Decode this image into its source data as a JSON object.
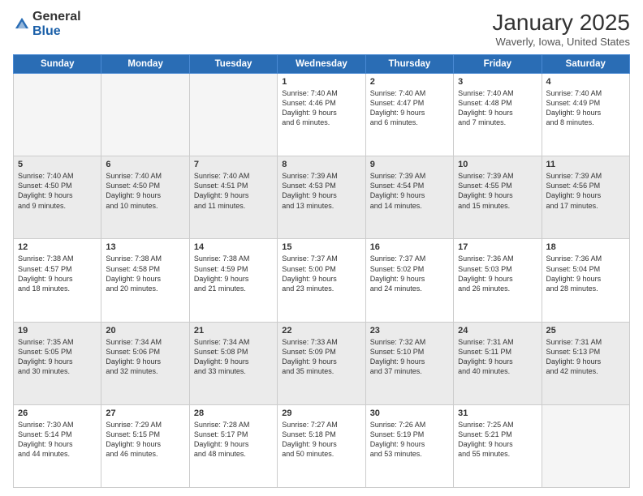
{
  "header": {
    "logo_general": "General",
    "logo_blue": "Blue",
    "month": "January 2025",
    "location": "Waverly, Iowa, United States"
  },
  "weekdays": [
    "Sunday",
    "Monday",
    "Tuesday",
    "Wednesday",
    "Thursday",
    "Friday",
    "Saturday"
  ],
  "rows": [
    {
      "shaded": false,
      "cells": [
        {
          "day": "",
          "empty": true,
          "lines": []
        },
        {
          "day": "",
          "empty": true,
          "lines": []
        },
        {
          "day": "",
          "empty": true,
          "lines": []
        },
        {
          "day": "1",
          "empty": false,
          "lines": [
            "Sunrise: 7:40 AM",
            "Sunset: 4:46 PM",
            "Daylight: 9 hours",
            "and 6 minutes."
          ]
        },
        {
          "day": "2",
          "empty": false,
          "lines": [
            "Sunrise: 7:40 AM",
            "Sunset: 4:47 PM",
            "Daylight: 9 hours",
            "and 6 minutes."
          ]
        },
        {
          "day": "3",
          "empty": false,
          "lines": [
            "Sunrise: 7:40 AM",
            "Sunset: 4:48 PM",
            "Daylight: 9 hours",
            "and 7 minutes."
          ]
        },
        {
          "day": "4",
          "empty": false,
          "lines": [
            "Sunrise: 7:40 AM",
            "Sunset: 4:49 PM",
            "Daylight: 9 hours",
            "and 8 minutes."
          ]
        }
      ]
    },
    {
      "shaded": true,
      "cells": [
        {
          "day": "5",
          "empty": false,
          "lines": [
            "Sunrise: 7:40 AM",
            "Sunset: 4:50 PM",
            "Daylight: 9 hours",
            "and 9 minutes."
          ]
        },
        {
          "day": "6",
          "empty": false,
          "lines": [
            "Sunrise: 7:40 AM",
            "Sunset: 4:50 PM",
            "Daylight: 9 hours",
            "and 10 minutes."
          ]
        },
        {
          "day": "7",
          "empty": false,
          "lines": [
            "Sunrise: 7:40 AM",
            "Sunset: 4:51 PM",
            "Daylight: 9 hours",
            "and 11 minutes."
          ]
        },
        {
          "day": "8",
          "empty": false,
          "lines": [
            "Sunrise: 7:39 AM",
            "Sunset: 4:53 PM",
            "Daylight: 9 hours",
            "and 13 minutes."
          ]
        },
        {
          "day": "9",
          "empty": false,
          "lines": [
            "Sunrise: 7:39 AM",
            "Sunset: 4:54 PM",
            "Daylight: 9 hours",
            "and 14 minutes."
          ]
        },
        {
          "day": "10",
          "empty": false,
          "lines": [
            "Sunrise: 7:39 AM",
            "Sunset: 4:55 PM",
            "Daylight: 9 hours",
            "and 15 minutes."
          ]
        },
        {
          "day": "11",
          "empty": false,
          "lines": [
            "Sunrise: 7:39 AM",
            "Sunset: 4:56 PM",
            "Daylight: 9 hours",
            "and 17 minutes."
          ]
        }
      ]
    },
    {
      "shaded": false,
      "cells": [
        {
          "day": "12",
          "empty": false,
          "lines": [
            "Sunrise: 7:38 AM",
            "Sunset: 4:57 PM",
            "Daylight: 9 hours",
            "and 18 minutes."
          ]
        },
        {
          "day": "13",
          "empty": false,
          "lines": [
            "Sunrise: 7:38 AM",
            "Sunset: 4:58 PM",
            "Daylight: 9 hours",
            "and 20 minutes."
          ]
        },
        {
          "day": "14",
          "empty": false,
          "lines": [
            "Sunrise: 7:38 AM",
            "Sunset: 4:59 PM",
            "Daylight: 9 hours",
            "and 21 minutes."
          ]
        },
        {
          "day": "15",
          "empty": false,
          "lines": [
            "Sunrise: 7:37 AM",
            "Sunset: 5:00 PM",
            "Daylight: 9 hours",
            "and 23 minutes."
          ]
        },
        {
          "day": "16",
          "empty": false,
          "lines": [
            "Sunrise: 7:37 AM",
            "Sunset: 5:02 PM",
            "Daylight: 9 hours",
            "and 24 minutes."
          ]
        },
        {
          "day": "17",
          "empty": false,
          "lines": [
            "Sunrise: 7:36 AM",
            "Sunset: 5:03 PM",
            "Daylight: 9 hours",
            "and 26 minutes."
          ]
        },
        {
          "day": "18",
          "empty": false,
          "lines": [
            "Sunrise: 7:36 AM",
            "Sunset: 5:04 PM",
            "Daylight: 9 hours",
            "and 28 minutes."
          ]
        }
      ]
    },
    {
      "shaded": true,
      "cells": [
        {
          "day": "19",
          "empty": false,
          "lines": [
            "Sunrise: 7:35 AM",
            "Sunset: 5:05 PM",
            "Daylight: 9 hours",
            "and 30 minutes."
          ]
        },
        {
          "day": "20",
          "empty": false,
          "lines": [
            "Sunrise: 7:34 AM",
            "Sunset: 5:06 PM",
            "Daylight: 9 hours",
            "and 32 minutes."
          ]
        },
        {
          "day": "21",
          "empty": false,
          "lines": [
            "Sunrise: 7:34 AM",
            "Sunset: 5:08 PM",
            "Daylight: 9 hours",
            "and 33 minutes."
          ]
        },
        {
          "day": "22",
          "empty": false,
          "lines": [
            "Sunrise: 7:33 AM",
            "Sunset: 5:09 PM",
            "Daylight: 9 hours",
            "and 35 minutes."
          ]
        },
        {
          "day": "23",
          "empty": false,
          "lines": [
            "Sunrise: 7:32 AM",
            "Sunset: 5:10 PM",
            "Daylight: 9 hours",
            "and 37 minutes."
          ]
        },
        {
          "day": "24",
          "empty": false,
          "lines": [
            "Sunrise: 7:31 AM",
            "Sunset: 5:11 PM",
            "Daylight: 9 hours",
            "and 40 minutes."
          ]
        },
        {
          "day": "25",
          "empty": false,
          "lines": [
            "Sunrise: 7:31 AM",
            "Sunset: 5:13 PM",
            "Daylight: 9 hours",
            "and 42 minutes."
          ]
        }
      ]
    },
    {
      "shaded": false,
      "cells": [
        {
          "day": "26",
          "empty": false,
          "lines": [
            "Sunrise: 7:30 AM",
            "Sunset: 5:14 PM",
            "Daylight: 9 hours",
            "and 44 minutes."
          ]
        },
        {
          "day": "27",
          "empty": false,
          "lines": [
            "Sunrise: 7:29 AM",
            "Sunset: 5:15 PM",
            "Daylight: 9 hours",
            "and 46 minutes."
          ]
        },
        {
          "day": "28",
          "empty": false,
          "lines": [
            "Sunrise: 7:28 AM",
            "Sunset: 5:17 PM",
            "Daylight: 9 hours",
            "and 48 minutes."
          ]
        },
        {
          "day": "29",
          "empty": false,
          "lines": [
            "Sunrise: 7:27 AM",
            "Sunset: 5:18 PM",
            "Daylight: 9 hours",
            "and 50 minutes."
          ]
        },
        {
          "day": "30",
          "empty": false,
          "lines": [
            "Sunrise: 7:26 AM",
            "Sunset: 5:19 PM",
            "Daylight: 9 hours",
            "and 53 minutes."
          ]
        },
        {
          "day": "31",
          "empty": false,
          "lines": [
            "Sunrise: 7:25 AM",
            "Sunset: 5:21 PM",
            "Daylight: 9 hours",
            "and 55 minutes."
          ]
        },
        {
          "day": "",
          "empty": true,
          "lines": []
        }
      ]
    }
  ]
}
